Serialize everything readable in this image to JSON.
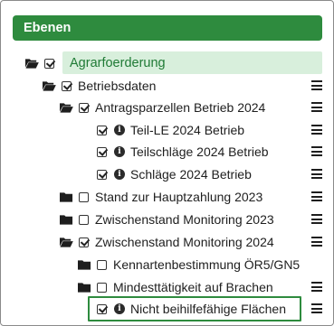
{
  "panel": {
    "title": "Ebenen",
    "accent": "#2e8b3e",
    "highlight": "#d8efdc"
  },
  "tree": {
    "root": {
      "label": "Agrarfoerderung",
      "checked": true
    },
    "betriebsdaten": {
      "label": "Betriebsdaten",
      "checked": true
    },
    "antragsparzellen": {
      "label": "Antragsparzellen Betrieb 2024",
      "checked": true
    },
    "teil_le": {
      "label": "Teil-LE 2024 Betrieb",
      "checked": true
    },
    "teilschlaege": {
      "label": "Teilschläge 2024 Betrieb",
      "checked": true
    },
    "schlaege": {
      "label": "Schläge 2024 Betrieb",
      "checked": true
    },
    "stand_hauptzahlung": {
      "label": "Stand zur Hauptzahlung 2023",
      "checked": false
    },
    "zwischenstand_2023": {
      "label": "Zwischenstand Monitoring 2023",
      "checked": false
    },
    "zwischenstand_2024": {
      "label": "Zwischenstand Monitoring 2024",
      "checked": true
    },
    "kennarten": {
      "label": "Kennartenbestimmung ÖR5/GN5",
      "checked": false
    },
    "mindesttaetigkeit": {
      "label": "Mindesttätigkeit auf Brachen",
      "checked": false
    },
    "nicht_beihilfe": {
      "label": "Nicht beihilfefähige Flächen",
      "checked": true
    }
  },
  "icons": {
    "folder_open": "folder-open-icon",
    "folder_closed": "folder-icon",
    "info": "info-circle-icon",
    "menu": "hamburger-menu-icon"
  }
}
